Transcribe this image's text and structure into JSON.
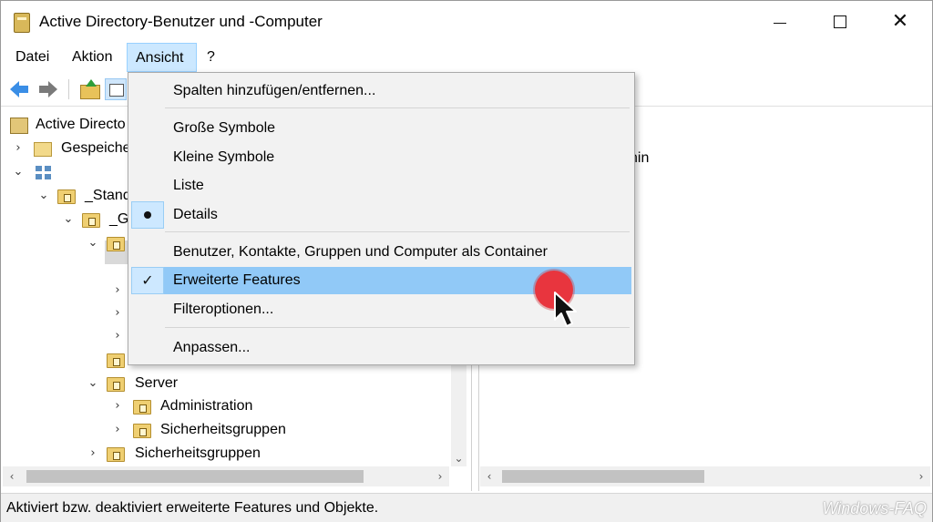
{
  "window": {
    "title": "Active Directory-Benutzer und -Computer",
    "controls": {
      "minimize": "",
      "maximize": "",
      "close": "✕"
    }
  },
  "menubar": {
    "items": [
      "Datei",
      "Aktion",
      "Ansicht",
      "?"
    ],
    "active": "Ansicht"
  },
  "toolbar": {
    "icons": [
      "back-arrow-icon",
      "forward-arrow-icon",
      "folder-up-icon",
      "console-tree-icon"
    ]
  },
  "tree": {
    "items": [
      {
        "label": "Active Directo",
        "icon": "ad-icon"
      },
      {
        "label": "Gespeiche",
        "icon": "folder-icon",
        "chevron": "›"
      },
      {
        "label": "",
        "icon": "domain-icon",
        "chevron": "⌄"
      },
      {
        "label": "_Stand",
        "icon": "ou-icon",
        "chevron": "⌄"
      },
      {
        "label": "_G",
        "icon": "ou-icon",
        "chevron": "⌄"
      },
      {
        "label": "",
        "icon": "ou-icon",
        "chevron": "⌄"
      },
      {
        "label": "",
        "chevron": "›"
      },
      {
        "label": "",
        "chevron": "›"
      },
      {
        "label": "",
        "chevron": "›"
      },
      {
        "label": "",
        "icon": "ou-icon"
      },
      {
        "label": "Server",
        "icon": "ou-icon",
        "chevron": "⌄"
      },
      {
        "label": "Administration",
        "icon": "ou-icon",
        "chevron": "›"
      },
      {
        "label": "Sicherheitsgruppen",
        "icon": "ou-icon",
        "chevron": "›"
      },
      {
        "label": "Sicherheitsgruppen",
        "icon": "ou-icon",
        "chevron": "›"
      }
    ]
  },
  "right_pane": {
    "visible_text": "nin"
  },
  "dropdown": {
    "items": [
      {
        "label": "Spalten hinzufügen/entfernen..."
      },
      {
        "label": "Große Symbole"
      },
      {
        "label": "Kleine Symbole"
      },
      {
        "label": "Liste"
      },
      {
        "label": "Details",
        "state": "selected-radio"
      },
      {
        "label": "Benutzer, Kontakte, Gruppen und Computer als Container"
      },
      {
        "label": "Erweiterte Features",
        "state": "checked",
        "highlighted": true
      },
      {
        "label": "Filteroptionen..."
      },
      {
        "label": "Anpassen..."
      }
    ]
  },
  "statusbar": {
    "text": "Aktiviert bzw. deaktiviert erweiterte Features und Objekte.",
    "watermark": "Windows-FAQ"
  },
  "scroll_glyphs": {
    "left": "‹",
    "right": "›",
    "down": "⌄"
  },
  "colors": {
    "menu_highlight": "#91c9f7",
    "menu_active_bg": "#cce8ff",
    "click_marker": "#e8353e"
  }
}
